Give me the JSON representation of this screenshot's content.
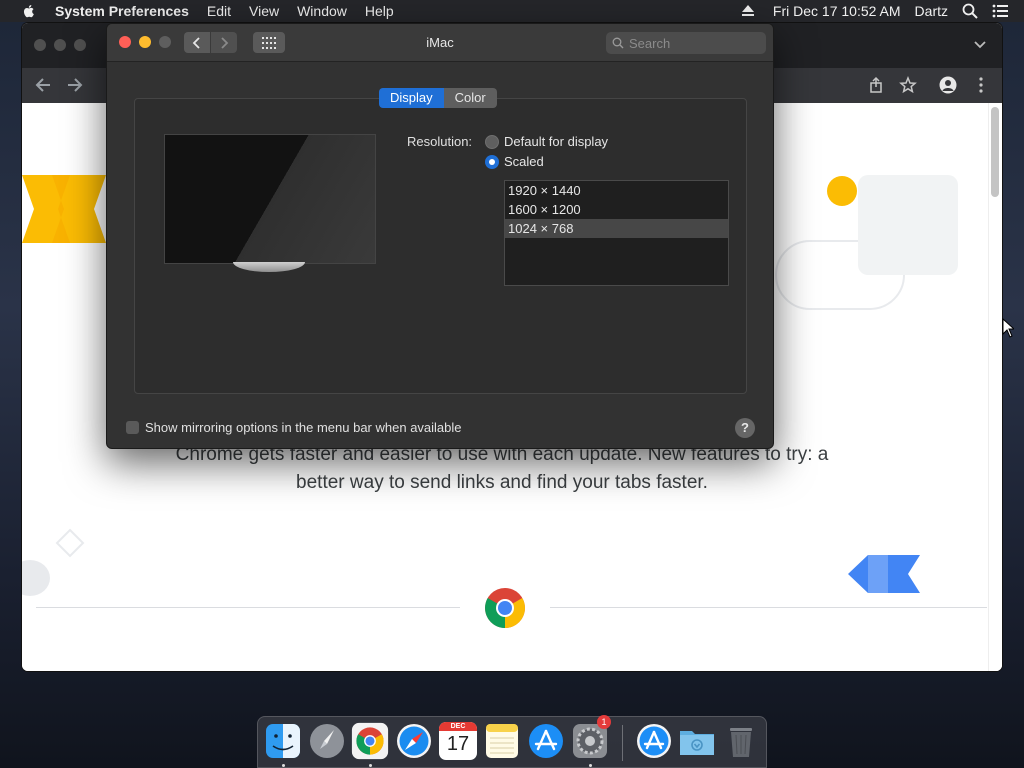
{
  "menubar": {
    "app_name": "System Preferences",
    "items": [
      "Edit",
      "View",
      "Window",
      "Help"
    ],
    "clock": "Fri Dec 17  10:52 AM",
    "user": "Dartz"
  },
  "chrome": {
    "promo_text": "Chrome gets faster and easier to use with each update. New features to try: a better way to send links and find your tabs faster."
  },
  "prefs": {
    "title": "iMac",
    "search_placeholder": "Search",
    "tabs": {
      "display": "Display",
      "color": "Color"
    },
    "resolution_label": "Resolution:",
    "radio_default": "Default for display",
    "radio_scaled": "Scaled",
    "resolutions": [
      "1920 × 1440",
      "1600 × 1200",
      "1024 × 768"
    ],
    "selected_resolution": "1024 × 768",
    "mirroring_label": "Show mirroring options in the menu bar when available",
    "help_label": "?"
  },
  "dock": {
    "calendar_month": "DEC",
    "calendar_day": "17",
    "prefs_badge": "1"
  },
  "colors": {
    "accent": "#1f6fd6",
    "close": "#ff5f57",
    "minimize": "#febc2e",
    "google_yellow": "#fbbc04",
    "google_blue": "#4285f4"
  }
}
